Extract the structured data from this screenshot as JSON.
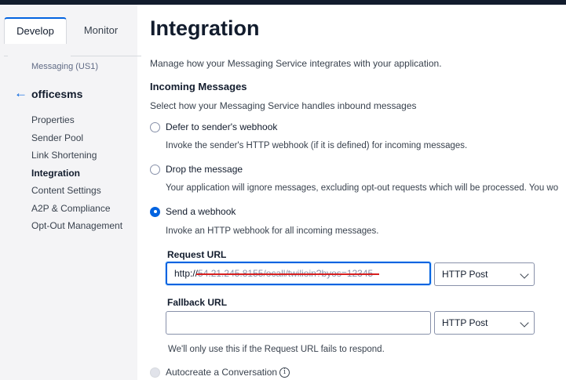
{
  "tabs": {
    "develop": "Develop",
    "monitor": "Monitor"
  },
  "sidebar": {
    "region": "Messaging (US1)",
    "service_name": "officesms",
    "items": [
      {
        "label": "Properties"
      },
      {
        "label": "Sender Pool"
      },
      {
        "label": "Link Shortening"
      },
      {
        "label": "Integration"
      },
      {
        "label": "Content Settings"
      },
      {
        "label": "A2P & Compliance"
      },
      {
        "label": "Opt-Out Management"
      }
    ],
    "active_item": "Integration"
  },
  "main": {
    "title": "Integration",
    "description": "Manage how your Messaging Service integrates with your application.",
    "incoming": {
      "title": "Incoming Messages",
      "description": "Select how your Messaging Service handles inbound messages",
      "options": [
        {
          "label": "Defer to sender's webhook",
          "help": "Invoke the sender's HTTP webhook (if it is defined) for incoming messages.",
          "checked": false
        },
        {
          "label": "Drop the message",
          "help": "Your application will ignore messages, excluding opt-out requests which will be processed. You wo",
          "checked": false
        },
        {
          "label": "Send a webhook",
          "help": "Invoke an HTTP webhook for all incoming messages.",
          "checked": true
        }
      ]
    },
    "request_url": {
      "label": "Request URL",
      "value_prefix": "http://",
      "value_redacted": "54.21.245.8155/ocall/twilioin?byos=12345",
      "method": "HTTP Post"
    },
    "fallback_url": {
      "label": "Fallback URL",
      "value": "",
      "method": "HTTP Post",
      "hint": "We'll only use this if the Request URL fails to respond."
    },
    "autocreate": {
      "label": "Autocreate a Conversation",
      "info_icon": "info-icon"
    }
  }
}
